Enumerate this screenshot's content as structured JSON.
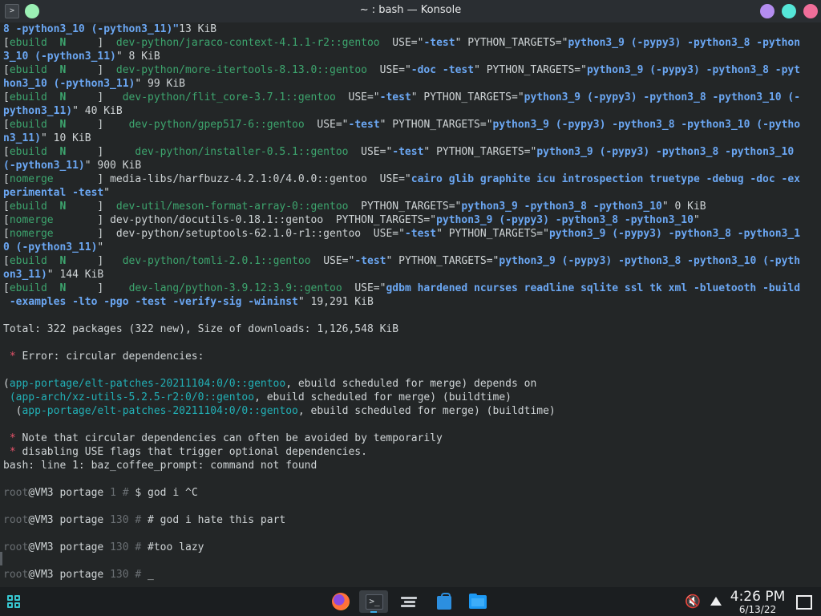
{
  "window": {
    "title": "~ : bash — Konsole",
    "terminal_icon": ">",
    "controls": {
      "minimize": "minimize",
      "maximize": "maximize",
      "close": "close"
    }
  },
  "terminal": {
    "lines": [
      [
        [
          "b",
          "8 -python3_10 (-python3_11)\""
        ],
        [
          "",
          "13 KiB"
        ]
      ],
      [
        [
          "",
          "["
        ],
        [
          "g",
          "ebuild"
        ],
        [
          "",
          "  "
        ],
        [
          "gb",
          "N"
        ],
        [
          "",
          "     ]  "
        ],
        [
          "g",
          "dev-python/jaraco-context-4.1.1-r2::gentoo"
        ],
        [
          "",
          "  USE=\""
        ],
        [
          "b",
          "-test"
        ],
        [
          "",
          "\" PYTHON_TARGETS=\""
        ],
        [
          "b",
          "python3_9 (-pypy3) -python3_8 -python"
        ]
      ],
      [
        [
          "b",
          "3_10 (-python3_11)"
        ],
        [
          "",
          "\" 8 KiB"
        ]
      ],
      [
        [
          "",
          "["
        ],
        [
          "g",
          "ebuild"
        ],
        [
          "",
          "  "
        ],
        [
          "gb",
          "N"
        ],
        [
          "",
          "     ]  "
        ],
        [
          "g",
          "dev-python/more-itertools-8.13.0::gentoo"
        ],
        [
          "",
          "  USE=\""
        ],
        [
          "b",
          "-doc -test"
        ],
        [
          "",
          "\" PYTHON_TARGETS=\""
        ],
        [
          "b",
          "python3_9 (-pypy3) -python3_8 -pyt"
        ]
      ],
      [
        [
          "b",
          "hon3_10 (-python3_11)"
        ],
        [
          "",
          "\" 99 KiB"
        ]
      ],
      [
        [
          "",
          "["
        ],
        [
          "g",
          "ebuild"
        ],
        [
          "",
          "  "
        ],
        [
          "gb",
          "N"
        ],
        [
          "",
          "     ]   "
        ],
        [
          "g",
          "dev-python/flit_core-3.7.1::gentoo"
        ],
        [
          "",
          "  USE=\""
        ],
        [
          "b",
          "-test"
        ],
        [
          "",
          "\" PYTHON_TARGETS=\""
        ],
        [
          "b",
          "python3_9 (-pypy3) -python3_8 -python3_10 (-"
        ]
      ],
      [
        [
          "b",
          "python3_11)"
        ],
        [
          "",
          "\" 40 KiB"
        ]
      ],
      [
        [
          "",
          "["
        ],
        [
          "g",
          "ebuild"
        ],
        [
          "",
          "  "
        ],
        [
          "gb",
          "N"
        ],
        [
          "",
          "     ]    "
        ],
        [
          "g",
          "dev-python/gpep517-6::gentoo"
        ],
        [
          "",
          "  USE=\""
        ],
        [
          "b",
          "-test"
        ],
        [
          "",
          "\" PYTHON_TARGETS=\""
        ],
        [
          "b",
          "python3_9 (-pypy3) -python3_8 -python3_10 (-pytho"
        ]
      ],
      [
        [
          "b",
          "n3_11)"
        ],
        [
          "",
          "\" 10 KiB"
        ]
      ],
      [
        [
          "",
          "["
        ],
        [
          "g",
          "ebuild"
        ],
        [
          "",
          "  "
        ],
        [
          "gb",
          "N"
        ],
        [
          "",
          "     ]     "
        ],
        [
          "g",
          "dev-python/installer-0.5.1::gentoo"
        ],
        [
          "",
          "  USE=\""
        ],
        [
          "b",
          "-test"
        ],
        [
          "",
          "\" PYTHON_TARGETS=\""
        ],
        [
          "b",
          "python3_9 (-pypy3) -python3_8 -python3_10"
        ]
      ],
      [
        [
          "b",
          "(-python3_11)"
        ],
        [
          "",
          "\" 900 KiB"
        ]
      ],
      [
        [
          "",
          "["
        ],
        [
          "g",
          "nomerge"
        ],
        [
          "",
          "       ] media-libs/harfbuzz-4.2.1:0/4.0.0::gentoo  USE=\""
        ],
        [
          "b",
          "cairo glib graphite icu introspection truetype -debug -doc -ex"
        ]
      ],
      [
        [
          "b",
          "perimental -test"
        ],
        [
          "",
          "\""
        ]
      ],
      [
        [
          "",
          "["
        ],
        [
          "g",
          "ebuild"
        ],
        [
          "",
          "  "
        ],
        [
          "gb",
          "N"
        ],
        [
          "",
          "     ]  "
        ],
        [
          "g",
          "dev-util/meson-format-array-0::gentoo"
        ],
        [
          "",
          "  PYTHON_TARGETS=\""
        ],
        [
          "b",
          "python3_9 -python3_8 -python3_10"
        ],
        [
          "",
          "\" 0 KiB"
        ]
      ],
      [
        [
          "",
          "["
        ],
        [
          "g",
          "nomerge"
        ],
        [
          "",
          "       ] dev-python/docutils-0.18.1::gentoo  PYTHON_TARGETS=\""
        ],
        [
          "b",
          "python3_9 (-pypy3) -python3_8 -python3_10"
        ],
        [
          "",
          "\""
        ]
      ],
      [
        [
          "",
          "["
        ],
        [
          "g",
          "nomerge"
        ],
        [
          "",
          "       ]  dev-python/setuptools-62.1.0-r1::gentoo  USE=\""
        ],
        [
          "b",
          "-test"
        ],
        [
          "",
          "\" PYTHON_TARGETS=\""
        ],
        [
          "b",
          "python3_9 (-pypy3) -python3_8 -python3_1"
        ]
      ],
      [
        [
          "b",
          "0 (-python3_11)"
        ],
        [
          "",
          "\""
        ]
      ],
      [
        [
          "",
          "["
        ],
        [
          "g",
          "ebuild"
        ],
        [
          "",
          "  "
        ],
        [
          "gb",
          "N"
        ],
        [
          "",
          "     ]   "
        ],
        [
          "g",
          "dev-python/tomli-2.0.1::gentoo"
        ],
        [
          "",
          "  USE=\""
        ],
        [
          "b",
          "-test"
        ],
        [
          "",
          "\" PYTHON_TARGETS=\""
        ],
        [
          "b",
          "python3_9 (-pypy3) -python3_8 -python3_10 (-pyth"
        ]
      ],
      [
        [
          "b",
          "on3_11)"
        ],
        [
          "",
          "\" 144 KiB"
        ]
      ],
      [
        [
          "",
          "["
        ],
        [
          "g",
          "ebuild"
        ],
        [
          "",
          "  "
        ],
        [
          "gb",
          "N"
        ],
        [
          "",
          "     ]    "
        ],
        [
          "g",
          "dev-lang/python-3.9.12:3.9::gentoo"
        ],
        [
          "",
          "  USE=\""
        ],
        [
          "b",
          "gdbm hardened ncurses readline sqlite ssl tk xml -bluetooth -build"
        ]
      ],
      [
        [
          "b",
          " -examples -lto -pgo -test -verify-sig -wininst"
        ],
        [
          "",
          "\" 19,291 KiB"
        ]
      ],
      [
        [
          "",
          ""
        ]
      ],
      [
        [
          "",
          "Total: 322 packages (322 new), Size of downloads: 1,126,548 KiB"
        ]
      ],
      [
        [
          "",
          ""
        ]
      ],
      [
        [
          "r",
          " * "
        ],
        [
          "",
          "Error: circular dependencies:"
        ]
      ],
      [
        [
          "",
          ""
        ]
      ],
      [
        [
          "",
          "("
        ],
        [
          "c",
          "app-portage/elt-patches-20211104:0/0::gentoo"
        ],
        [
          "",
          ", ebuild scheduled for merge) depends on"
        ]
      ],
      [
        [
          "",
          ""
        ],
        [
          "c",
          " (app-arch/xz-utils-5.2.5-r2:0/0::gentoo"
        ],
        [
          "",
          ", ebuild scheduled for merge) (buildtime)"
        ]
      ],
      [
        [
          "",
          "  ("
        ],
        [
          "c",
          "app-portage/elt-patches-20211104:0/0::gentoo"
        ],
        [
          "",
          ", ebuild scheduled for merge) (buildtime)"
        ]
      ],
      [
        [
          "",
          ""
        ]
      ],
      [
        [
          "r",
          " * "
        ],
        [
          "",
          "Note that circular dependencies can often be avoided by temporarily"
        ]
      ],
      [
        [
          "r",
          " * "
        ],
        [
          "",
          "disabling USE flags that trigger optional dependencies."
        ]
      ],
      [
        [
          "",
          "bash: line 1: baz_coffee_prompt: command not found"
        ]
      ],
      [
        [
          "",
          ""
        ]
      ],
      [
        [
          "m",
          "root"
        ],
        [
          "",
          "@VM3 portage "
        ],
        [
          "m",
          "1"
        ],
        [
          "m",
          " # "
        ],
        [
          "",
          "$ god i ^C"
        ]
      ],
      [
        [
          "",
          ""
        ]
      ],
      [
        [
          "m",
          "root"
        ],
        [
          "",
          "@VM3 portage "
        ],
        [
          "m",
          "130"
        ],
        [
          "m",
          " # "
        ],
        [
          "",
          "# god i hate this part"
        ]
      ],
      [
        [
          "",
          ""
        ]
      ],
      [
        [
          "m",
          "root"
        ],
        [
          "",
          "@VM3 portage "
        ],
        [
          "m",
          "130"
        ],
        [
          "m",
          " # "
        ],
        [
          "",
          "#too lazy"
        ]
      ],
      [
        [
          "",
          ""
        ]
      ],
      [
        [
          "m",
          "root"
        ],
        [
          "",
          "@VM3 portage "
        ],
        [
          "m",
          "130"
        ],
        [
          "m",
          " # "
        ],
        [
          "",
          "_"
        ]
      ]
    ]
  },
  "taskbar": {
    "launcher_icon": "application-launcher-icon",
    "apps": [
      "firefox-icon",
      "konsole-icon",
      "system-settings-icon",
      "discover-icon",
      "dolphin-files-icon"
    ],
    "volume_glyph": "🔇",
    "clock": {
      "time": "4:26 PM",
      "date": "6/13/22"
    },
    "colors": {
      "accent": "#3daee9",
      "panel": "#1b1e20"
    }
  }
}
